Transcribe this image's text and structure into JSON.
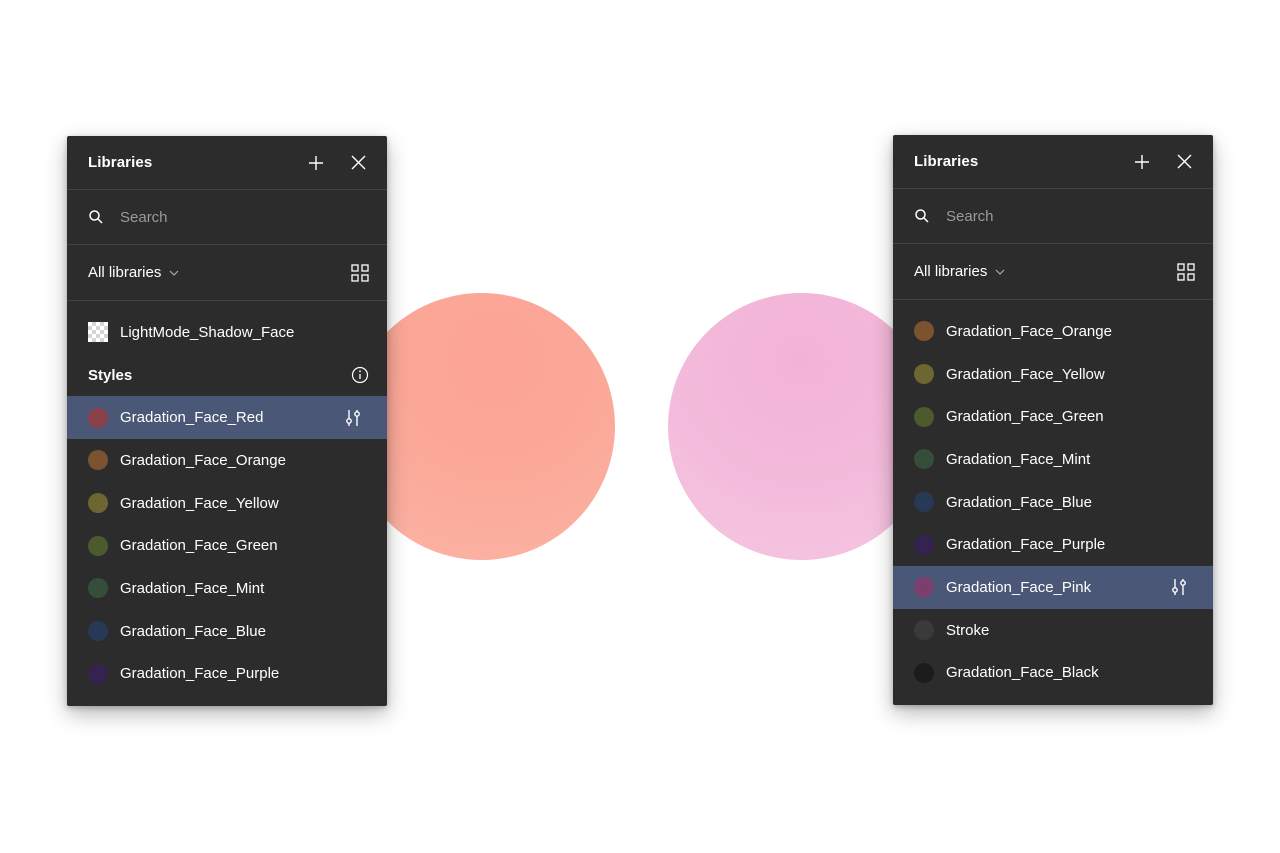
{
  "left_panel": {
    "title": "Libraries",
    "search_placeholder": "Search",
    "filter_label": "All libraries",
    "library_item": "LightMode_Shadow_Face",
    "section_title": "Styles",
    "styles": [
      {
        "label": "Gradation_Face_Red",
        "color": "#8a4149",
        "selected": true
      },
      {
        "label": "Gradation_Face_Orange",
        "color": "#7b5331"
      },
      {
        "label": "Gradation_Face_Yellow",
        "color": "#6d6630"
      },
      {
        "label": "Gradation_Face_Green",
        "color": "#4c5a2d"
      },
      {
        "label": "Gradation_Face_Mint",
        "color": "#344e39"
      },
      {
        "label": "Gradation_Face_Blue",
        "color": "#283956"
      },
      {
        "label": "Gradation_Face_Purple",
        "color": "#34224f"
      }
    ]
  },
  "right_panel": {
    "title": "Libraries",
    "search_placeholder": "Search",
    "filter_label": "All libraries",
    "styles": [
      {
        "label": "Gradation_Face_Orange",
        "color": "#7b5331"
      },
      {
        "label": "Gradation_Face_Yellow",
        "color": "#6d6630"
      },
      {
        "label": "Gradation_Face_Green",
        "color": "#4c5a2d"
      },
      {
        "label": "Gradation_Face_Mint",
        "color": "#344e39"
      },
      {
        "label": "Gradation_Face_Blue",
        "color": "#283956"
      },
      {
        "label": "Gradation_Face_Purple",
        "color": "#34224f"
      },
      {
        "label": "Gradation_Face_Pink",
        "color": "#7b3f6e",
        "selected": true
      },
      {
        "label": "Stroke",
        "color": "#3a3a3a"
      },
      {
        "label": "Gradation_Face_Black",
        "color": "#1c1c1c"
      }
    ]
  },
  "canvas": {
    "left_blob_color": "#fba898",
    "right_blob_color": "#f3b9da",
    "selection_color": "#4b5777",
    "panel_color": "#2c2c2c"
  }
}
